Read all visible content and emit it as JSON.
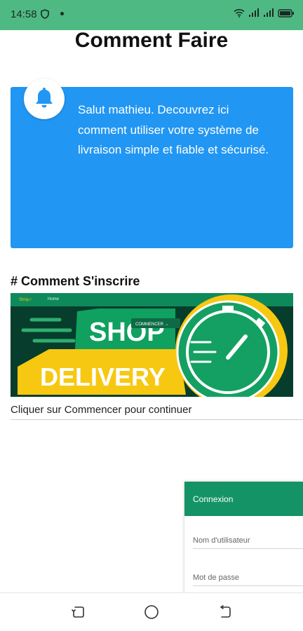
{
  "status_bar": {
    "time": "14:58",
    "icons": [
      "shield-icon",
      "dot-icon",
      "wifi-icon",
      "signal-icon",
      "signal-icon",
      "battery-icon"
    ],
    "background": "#4fb984"
  },
  "page": {
    "title": "Comment Faire"
  },
  "info_card": {
    "icon": "bell-icon",
    "text": "Salut mathieu. Decouvrez ici comment utiliser votre système de livraison simple et fiable et sécurisé.",
    "background": "#2196f3"
  },
  "section": {
    "heading": "# Comment S'inscrire",
    "banner": {
      "nav_brand": "Sh¤p✓",
      "nav_link": "Home",
      "word_shop": "SHOP",
      "word_delivery": "DELIVERY",
      "button_label": "COMMENCER →"
    },
    "caption": "Cliquer sur Commencer pour continuer"
  },
  "login_panel": {
    "title": "Connexion",
    "username_placeholder": "Nom d'utilisateur",
    "password_placeholder": "Mot de passe",
    "accent": "#149466"
  },
  "nav_bar": {
    "buttons": [
      "recent-apps-icon",
      "home-icon",
      "back-icon"
    ]
  }
}
